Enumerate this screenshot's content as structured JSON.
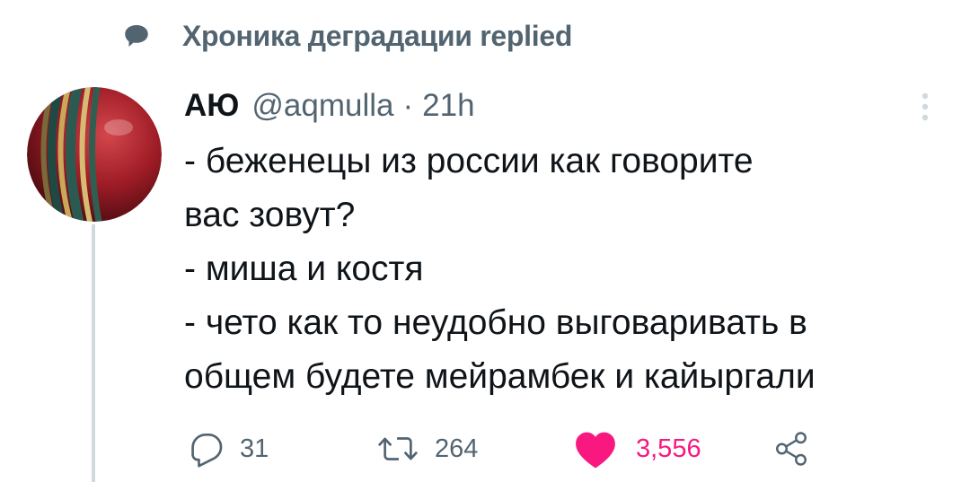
{
  "context": {
    "icon": "comment-bubble-icon",
    "text": "Хроника деградации replied"
  },
  "tweet": {
    "author_name": "АЮ",
    "handle": "@aqmulla",
    "separator": "·",
    "time": "21h",
    "text_lines": [
      "- беженецы из россии как говорите",
      "вас зовут?",
      "- миша и костя",
      "- чето как то неудобно выговаривать в",
      "общем будете мейрамбек и кайыргали"
    ]
  },
  "actions": {
    "reply": {
      "icon": "reply-icon",
      "count": "31"
    },
    "retweet": {
      "icon": "retweet-icon",
      "count": "264"
    },
    "like": {
      "icon": "heart-filled-icon",
      "count": "3,556",
      "liked": true
    },
    "share": {
      "icon": "share-icon"
    }
  },
  "colors": {
    "text": "#0f1419",
    "secondary": "#536471",
    "like": "#f91880",
    "thread_line": "#cfd9de"
  }
}
